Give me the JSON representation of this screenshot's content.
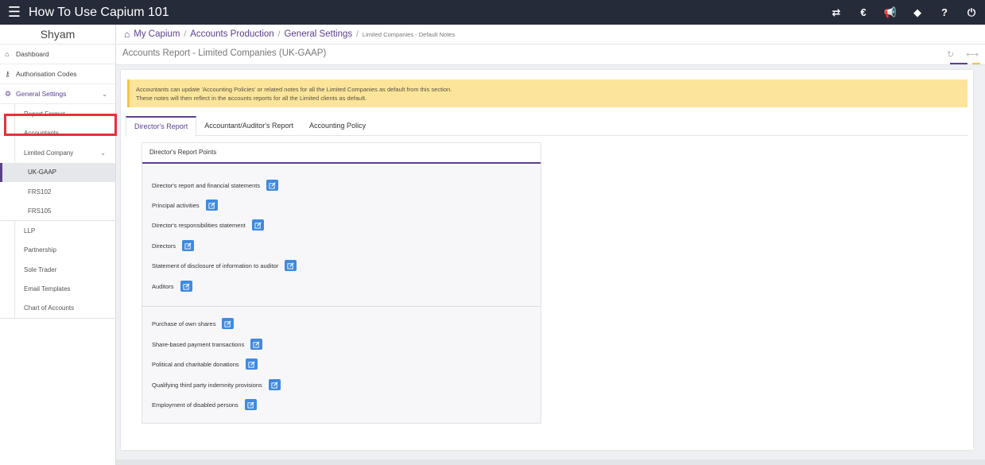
{
  "topbar": {
    "title": "How To Use Capium 101",
    "icons": [
      "arrows-icon",
      "currency-icon",
      "megaphone-icon",
      "tag-icon",
      "help-icon",
      "power-icon"
    ]
  },
  "sidebar": {
    "user": "Shyam",
    "items": [
      {
        "label": "Dashboard",
        "icon": "home-icon"
      },
      {
        "label": "Authorisation Codes",
        "icon": "key-icon"
      },
      {
        "label": "General Settings",
        "icon": "gears-icon"
      }
    ],
    "sub_items": [
      "Report Format",
      "Accountants",
      "Limited Company"
    ],
    "sub_sub_items": [
      "UK-GAAP",
      "FRS102",
      "FRS105"
    ],
    "more_items": [
      "LLP",
      "Partnership",
      "Sole Trader",
      "Email Templates",
      "Chart of Accounts"
    ]
  },
  "breadcrumb": {
    "items": [
      "My Capium",
      "Accounts Production",
      "General Settings"
    ],
    "current": "Limited Companies - Default Notes"
  },
  "page_title": "Accounts Report - Limited Companies (UK-GAAP)",
  "notice": {
    "line1": "Accountants can update 'Accounting Policies' or related notes for all the Limited Companies as default from this section.",
    "line2": "These notes will then reflect in the accounts reports for all the Limited clients as default."
  },
  "tabs": [
    "Director's Report",
    "Accountant/Auditor's Report",
    "Accounting Policy"
  ],
  "card": {
    "header": "Director's Report Points",
    "group1": [
      "Director's report and financial statements",
      "Principal activities",
      "Director's responsibilities statement",
      "Directors",
      "Statement of disclosure of information to auditor",
      "Auditors"
    ],
    "group2": [
      "Purchase of own shares",
      "Share-based payment transactions",
      "Political and charitable donations",
      "Qualifying third party indemnity provisions",
      "Employment of disabled persons"
    ]
  },
  "colors": {
    "topbar": "#252b38",
    "accent": "#5b3f8f",
    "notice": "#fce59a",
    "edit_button": "#3f8ae2",
    "highlight": "#e53238"
  }
}
